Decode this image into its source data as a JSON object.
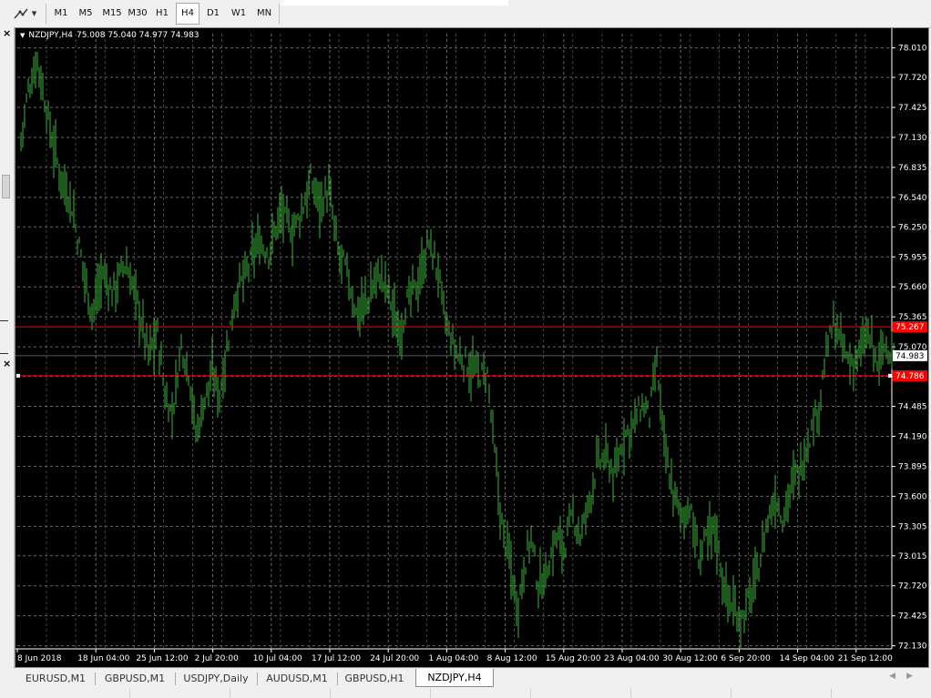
{
  "toolbar": {
    "timeframes": [
      {
        "label": "M1",
        "active": false
      },
      {
        "label": "M5",
        "active": false
      },
      {
        "label": "M15",
        "active": false
      },
      {
        "label": "M30",
        "active": false
      },
      {
        "label": "H1",
        "active": false
      },
      {
        "label": "H4",
        "active": true
      },
      {
        "label": "D1",
        "active": false
      },
      {
        "label": "W1",
        "active": false
      },
      {
        "label": "MN",
        "active": false
      }
    ],
    "tool_icon": "line-studies-icon"
  },
  "chart_header": {
    "symbol": "NZDJPY,H4",
    "ohlc": "75.008 75.040 74.977 74.983"
  },
  "chart_data": {
    "type": "bar",
    "instrument": "NZDJPY",
    "timeframe": "H4",
    "ylim": [
      72.1,
      78.15
    ],
    "price_ticks": [
      "78.010",
      "77.720",
      "77.425",
      "77.130",
      "76.835",
      "76.540",
      "76.250",
      "75.955",
      "75.660",
      "75.365",
      "75.070",
      "74.780",
      "74.485",
      "74.190",
      "73.895",
      "73.600",
      "73.305",
      "73.015",
      "72.720",
      "72.425",
      "72.130"
    ],
    "time_ticks": [
      "8 Jun 2018",
      "18 Jun 04:00",
      "25 Jun 12:00",
      "2 Jul 20:00",
      "10 Jul 04:00",
      "17 Jul 12:00",
      "24 Jul 20:00",
      "1 Aug 04:00",
      "8 Aug 12:00",
      "15 Aug 20:00",
      "23 Aug 04:00",
      "30 Aug 12:00",
      "6 Sep 20:00",
      "14 Sep 04:00",
      "21 Sep 12:00"
    ],
    "current_price": "74.983",
    "horizontal_lines": [
      {
        "price": 75.267,
        "label": "75.267",
        "color": "#ff0000"
      },
      {
        "price": 74.786,
        "label": "74.786",
        "color": "#ff0000"
      }
    ],
    "series": [
      {
        "color": "#3cb43c",
        "anchors": [
          [
            0,
            77.1
          ],
          [
            8,
            77.6
          ],
          [
            18,
            77.9
          ],
          [
            30,
            77.3
          ],
          [
            42,
            76.8
          ],
          [
            55,
            76.5
          ],
          [
            65,
            76.0
          ],
          [
            78,
            75.4
          ],
          [
            90,
            75.8
          ],
          [
            100,
            75.6
          ],
          [
            115,
            75.9
          ],
          [
            128,
            75.5
          ],
          [
            140,
            75.0
          ],
          [
            150,
            75.2
          ],
          [
            158,
            74.6
          ],
          [
            166,
            74.4
          ],
          [
            176,
            75.1
          ],
          [
            185,
            74.8
          ],
          [
            192,
            74.2
          ],
          [
            200,
            74.5
          ],
          [
            210,
            74.8
          ],
          [
            218,
            74.6
          ],
          [
            225,
            75.0
          ],
          [
            236,
            75.6
          ],
          [
            248,
            75.8
          ],
          [
            260,
            76.1
          ],
          [
            272,
            76.0
          ],
          [
            285,
            76.4
          ],
          [
            298,
            76.2
          ],
          [
            308,
            76.4
          ],
          [
            318,
            76.7
          ],
          [
            328,
            76.5
          ],
          [
            338,
            76.6
          ],
          [
            348,
            76.0
          ],
          [
            358,
            75.8
          ],
          [
            368,
            75.4
          ],
          [
            380,
            75.5
          ],
          [
            392,
            75.8
          ],
          [
            404,
            75.6
          ],
          [
            414,
            75.2
          ],
          [
            424,
            75.5
          ],
          [
            436,
            75.7
          ],
          [
            448,
            76.1
          ],
          [
            458,
            75.8
          ],
          [
            466,
            75.3
          ],
          [
            478,
            75.0
          ],
          [
            490,
            74.9
          ],
          [
            502,
            74.8
          ],
          [
            512,
            74.8
          ],
          [
            520,
            74.0
          ],
          [
            528,
            73.3
          ],
          [
            536,
            73.0
          ],
          [
            545,
            72.5
          ],
          [
            552,
            72.9
          ],
          [
            560,
            73.2
          ],
          [
            568,
            72.7
          ],
          [
            578,
            72.9
          ],
          [
            588,
            73.2
          ],
          [
            596,
            73.1
          ],
          [
            606,
            73.4
          ],
          [
            615,
            73.2
          ],
          [
            625,
            73.6
          ],
          [
            632,
            73.9
          ],
          [
            642,
            74.0
          ],
          [
            652,
            73.8
          ],
          [
            662,
            74.2
          ],
          [
            672,
            74.3
          ],
          [
            682,
            74.5
          ],
          [
            690,
            74.4
          ],
          [
            698,
            74.9
          ],
          [
            706,
            74.1
          ],
          [
            714,
            73.7
          ],
          [
            724,
            73.4
          ],
          [
            734,
            73.5
          ],
          [
            744,
            73.0
          ],
          [
            754,
            73.2
          ],
          [
            762,
            73.3
          ],
          [
            772,
            72.7
          ],
          [
            782,
            72.5
          ],
          [
            792,
            72.4
          ],
          [
            800,
            72.6
          ],
          [
            810,
            72.9
          ],
          [
            818,
            73.3
          ],
          [
            828,
            73.6
          ],
          [
            836,
            73.4
          ],
          [
            846,
            73.7
          ],
          [
            856,
            73.9
          ],
          [
            866,
            74.2
          ],
          [
            876,
            74.5
          ],
          [
            884,
            75.0
          ],
          [
            892,
            75.3
          ],
          [
            900,
            75.1
          ],
          [
            910,
            74.9
          ],
          [
            920,
            75.0
          ],
          [
            930,
            75.2
          ],
          [
            940,
            74.9
          ],
          [
            950,
            75.1
          ],
          [
            958,
            74.98
          ]
        ]
      }
    ]
  },
  "tabs": [
    {
      "label": "EURUSD,M1",
      "active": false
    },
    {
      "label": "GBPUSD,M1",
      "active": false
    },
    {
      "label": "USDJPY,Daily",
      "active": false
    },
    {
      "label": "AUDUSD,M1",
      "active": false
    },
    {
      "label": "GBPUSD,H1",
      "active": false
    },
    {
      "label": "NZDJPY,H4",
      "active": true
    }
  ],
  "colors": {
    "chart_bg": "#000000",
    "grid": "#6a6a6a",
    "bars": "#3cb43c",
    "level_line": "#ff0000",
    "axis_text": "#ffffff"
  }
}
